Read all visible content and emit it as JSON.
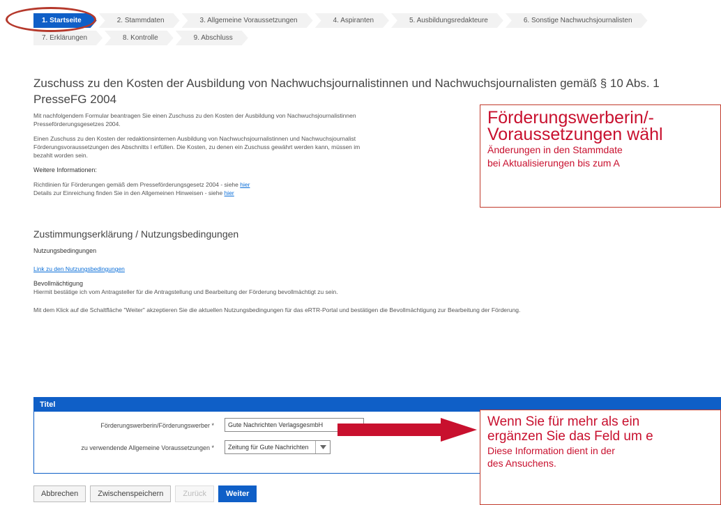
{
  "steps": {
    "row1": [
      "1. Startseite",
      "2. Stammdaten",
      "3. Allgemeine Voraussetzungen",
      "4. Aspiranten",
      "5. Ausbildungsredakteure",
      "6. Sonstige Nachwuchsjournalisten"
    ],
    "row2": [
      "7. Erklärungen",
      "8. Kontrolle",
      "9. Abschluss"
    ]
  },
  "content": {
    "title_line1": "Zuschuss zu den Kosten der Ausbildung von Nachwuchsjournalistinnen und Nachwuchsjournalisten gemäß § 10 Abs. 1",
    "title_line2": "PresseFG 2004",
    "intro1": "Mit nachfolgendem Formular beantragen Sie einen Zuschuss zu den Kosten der Ausbildung von Nachwuchsjournalistinnen",
    "intro1b": "Presseförderungsgesetzes 2004.",
    "intro2a": "Einen Zuschuss zu den Kosten der redaktionsinternen Ausbildung von Nachwuchsjournalistinnen und Nachwuchsjournalist",
    "intro2b": "Förderungsvoraussetzungen des Abschnitts I erfüllen. Die Kosten, zu denen ein Zuschuss gewährt werden kann, müssen im",
    "intro2c": "bezahlt worden sein.",
    "more_info": "Weitere Informationen:",
    "info1_text": "Richtlinien für Förderungen gemäß dem Presseförderungsgesetz 2004 - siehe ",
    "info1_link": "hier",
    "info2_text": "Details zur Einreichung finden Sie in den Allgemeinen Hinweisen - siehe ",
    "info2_link": "hier",
    "consent_title": "Zustimmungserklärung / Nutzungsbedingungen",
    "terms_label": "Nutzungsbedingungen",
    "terms_link": "Link zu den Nutzungsbedingungen",
    "power_label": "Bevollmächtigung",
    "power_text": "Hiermit bestätige ich vom Antragsteller für die Antragstellung und Bearbeitung der Förderung bevollmächtigt zu sein.",
    "accept_text": "Mit dem Klick auf die Schaltfläche \"Weiter\" akzeptieren Sie die aktuellen Nutzungsbedingungen für das eRTR-Portal und bestätigen die Bevollmächtigung zur Bearbeitung der Förderung."
  },
  "panel": {
    "title": "Titel",
    "field1_label": "Förderungswerberin/Förderungswerber *",
    "field1_value": "Gute Nachrichten VerlagsgesmbH",
    "field2_label": "zu verwendende Allgemeine Voraussetzungen *",
    "field2_value": "Zeitung für Gute Nachrichten"
  },
  "buttons": {
    "cancel": "Abbrechen",
    "save": "Zwischenspeichern",
    "back": "Zurück",
    "next": "Weiter"
  },
  "notes": {
    "note1_title1": "Förderungswerberin/-",
    "note1_title2": "Voraussetzungen wähl",
    "note1_sub1": "Änderungen in den Stammdate",
    "note1_sub2": "bei Aktualisierungen bis zum A",
    "note2_title1": "Wenn Sie für mehr als ein",
    "note2_title2": "ergänzen Sie das Feld um e",
    "note2_sub1": "Diese Information dient in der",
    "note2_sub2": "des Ansuchens."
  },
  "colors": {
    "accent": "#0f5fc7",
    "annotation": "#c8102e"
  }
}
